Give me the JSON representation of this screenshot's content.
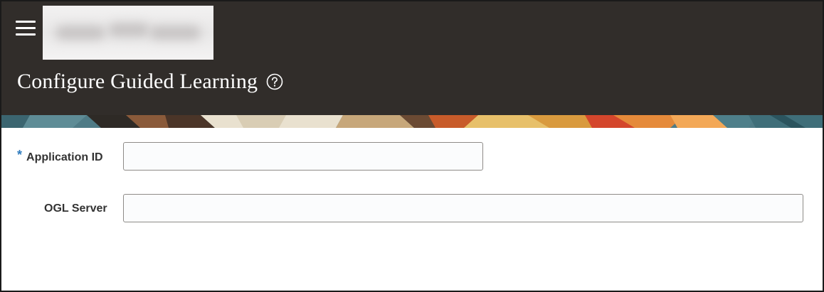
{
  "header": {
    "title": "Configure Guided Learning",
    "menu_icon": "hamburger-menu-icon",
    "help_icon": "help-circle-icon",
    "logo": "blurred-logo",
    "background_color": "#312d2a"
  },
  "form": {
    "fields": [
      {
        "label": "Application ID",
        "required": true,
        "required_marker": "*",
        "value": "",
        "placeholder": ""
      },
      {
        "label": "OGL Server",
        "required": false,
        "value": "",
        "placeholder": ""
      }
    ],
    "required_color": "#2f7bbd"
  }
}
